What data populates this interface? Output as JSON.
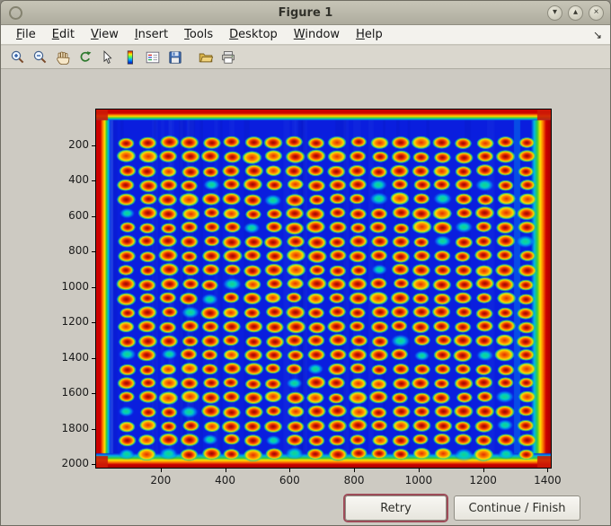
{
  "window": {
    "title": "Figure 1",
    "controls": [
      {
        "name": "minimize",
        "glyph": "▾"
      },
      {
        "name": "maximize",
        "glyph": "▴"
      },
      {
        "name": "close",
        "glyph": "×"
      }
    ]
  },
  "menu": {
    "items": [
      "File",
      "Edit",
      "View",
      "Insert",
      "Tools",
      "Desktop",
      "Window",
      "Help"
    ],
    "dock_glyph": "↘"
  },
  "toolbar": {
    "icons": [
      "zoom-in",
      "zoom-out",
      "pan",
      "rotate-3d",
      "edit-plot",
      "insert-colorbar",
      "insert-legend",
      "save-figure",
      "open-file",
      "print-figure"
    ]
  },
  "figure": {
    "axes": {
      "x_ticks": [
        200,
        400,
        600,
        800,
        1000,
        1200,
        1400
      ],
      "y_ticks": [
        200,
        400,
        600,
        800,
        1000,
        1200,
        1400,
        1600,
        1800,
        2000
      ],
      "x_max": 1410,
      "y_max": 2020
    },
    "plot": {
      "type": "image",
      "colormap": "jet",
      "grid_cols": 20,
      "grid_rows": 23,
      "background_color": "#0a1ede",
      "border_colors": [
        "#cc0000",
        "#ff7a00",
        "#ffe400",
        "#35cc3a",
        "#00b8e8"
      ],
      "dot_colors": {
        "core": "#8f0c00",
        "mid": "#ff6a00",
        "rim": "#ffd900",
        "halo": "#3ecf55"
      },
      "seed": 1337
    }
  },
  "buttons": {
    "retry_label": "Retry",
    "continue_label": "Continue / Finish"
  }
}
